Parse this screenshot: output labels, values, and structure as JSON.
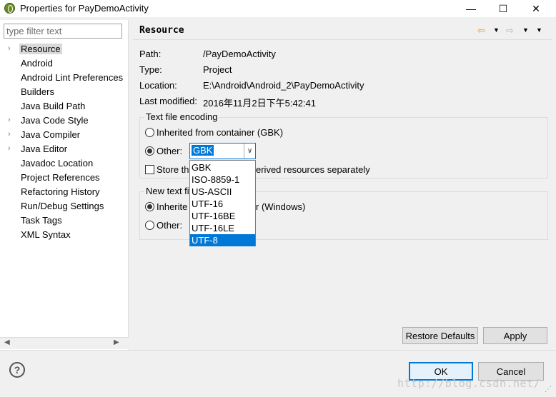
{
  "window": {
    "title": "Properties for PayDemoActivity",
    "min_glyph": "—",
    "max_glyph": "☐",
    "close_glyph": "✕"
  },
  "sidebar": {
    "filter_placeholder": "type filter text",
    "items": [
      {
        "label": "Resource",
        "expandable": true,
        "selected": true
      },
      {
        "label": "Android",
        "expandable": false
      },
      {
        "label": "Android Lint Preferences",
        "expandable": false
      },
      {
        "label": "Builders",
        "expandable": false
      },
      {
        "label": "Java Build Path",
        "expandable": false
      },
      {
        "label": "Java Code Style",
        "expandable": true
      },
      {
        "label": "Java Compiler",
        "expandable": true
      },
      {
        "label": "Java Editor",
        "expandable": true
      },
      {
        "label": "Javadoc Location",
        "expandable": false
      },
      {
        "label": "Project References",
        "expandable": false
      },
      {
        "label": "Refactoring History",
        "expandable": false
      },
      {
        "label": "Run/Debug Settings",
        "expandable": false
      },
      {
        "label": "Task Tags",
        "expandable": false
      },
      {
        "label": "XML Syntax",
        "expandable": false
      }
    ],
    "arrow_glyph": "›",
    "scroll_left_glyph": "◀",
    "scroll_right_glyph": "▶"
  },
  "page": {
    "title": "Resource",
    "back_glyph": "⇦",
    "forward_glyph": "⇨",
    "dropdown_glyph": "▼",
    "info": [
      {
        "label": "Path:",
        "value": "/PayDemoActivity"
      },
      {
        "label": "Type:",
        "value": "Project"
      },
      {
        "label": "Location:",
        "value": "E:\\Android\\Android_2\\PayDemoActivity"
      },
      {
        "label": "Last modified:",
        "value": "2016年11月2日下午5:42:41"
      }
    ],
    "encoding": {
      "group_title": "Text file encoding",
      "inherited_label": "Inherited from container (GBK)",
      "other_label": "Other:",
      "selected_value": "GBK",
      "store_label_left": "Store th",
      "store_label_right": "erived resources separately",
      "options": [
        "GBK",
        "ISO-8859-1",
        "US-ASCII",
        "UTF-16",
        "UTF-16BE",
        "UTF-16LE",
        "UTF-8"
      ],
      "highlighted_option": "UTF-8",
      "combo_arrow_glyph": "∨"
    },
    "delimiter": {
      "group_title": "New text fi",
      "inherited_label_left": "Inherite",
      "inherited_label_right": "r (Windows)",
      "other_label": "Other:"
    },
    "restore_defaults_label": "Restore Defaults",
    "apply_label": "Apply"
  },
  "footer": {
    "help_glyph": "?",
    "ok_label": "OK",
    "cancel_label": "Cancel",
    "watermark": "http://blog.csdn.net/",
    "grip_glyph": "⋰"
  },
  "colors": {
    "accent": "#0078d7",
    "panel_bg": "#ffffff",
    "dialog_bg": "#f0f0f0"
  }
}
